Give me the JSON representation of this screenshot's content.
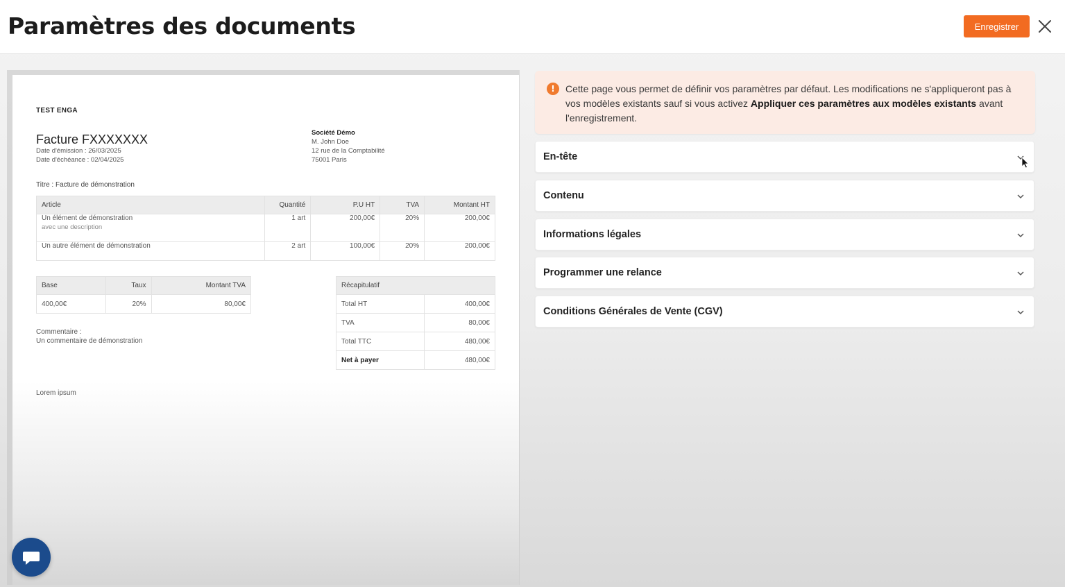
{
  "header": {
    "title": "Paramètres des documents",
    "save_label": "Enregistrer"
  },
  "document": {
    "company": "TEST ENGA",
    "invoice_title": "Facture FXXXXXXX",
    "issue_date": "Date d'émission : 26/03/2025",
    "due_date": "Date d'échéance : 02/04/2025",
    "client": {
      "name": "Société Démo",
      "contact": "M. John Doe",
      "address": "12 rue de la Comptabilité",
      "city": "75001 Paris"
    },
    "subject": "Titre : Facture de démonstration",
    "items_table": {
      "headers": [
        "Article",
        "Quantité",
        "P.U HT",
        "TVA",
        "Montant HT"
      ],
      "rows": [
        {
          "article": "Un élément de démonstration",
          "description": "avec une description",
          "qty": "1 art",
          "unit": "200,00€",
          "vat": "20%",
          "amount": "200,00€"
        },
        {
          "article": "Un autre élément de démonstration",
          "description": "",
          "qty": "2 art",
          "unit": "100,00€",
          "vat": "20%",
          "amount": "200,00€"
        }
      ]
    },
    "vat_table": {
      "headers": [
        "Base",
        "Taux",
        "Montant TVA"
      ],
      "row": [
        "400,00€",
        "20%",
        "80,00€"
      ]
    },
    "recap_table": {
      "header": "Récapitulatif",
      "rows": [
        {
          "label": "Total HT",
          "value": "400,00€"
        },
        {
          "label": "TVA",
          "value": "80,00€"
        },
        {
          "label": "Total TTC",
          "value": "480,00€"
        },
        {
          "label": "Net à payer",
          "value": "480,00€"
        }
      ]
    },
    "comment_label": "Commentaire :",
    "comment_text": "Un commentaire de démonstration",
    "footer_text": "Lorem ipsum"
  },
  "info": {
    "text_before": "Cette page vous permet de définir vos paramètres par défaut. Les modifications ne s'appliqueront pas à vos modèles existants sauf si vous activez ",
    "text_bold": "Appliquer ces paramètres aux modèles existants",
    "text_after": " avant l'enregistrement."
  },
  "sections": [
    {
      "label": "En-tête"
    },
    {
      "label": "Contenu"
    },
    {
      "label": "Informations légales"
    },
    {
      "label": "Programmer une relance"
    },
    {
      "label": "Conditions Générales de Vente (CGV)"
    }
  ],
  "colors": {
    "accent": "#f26b21",
    "info_bg": "#fcebe4",
    "chat_button": "#1b4b8c"
  },
  "icons": [
    "close-icon",
    "info-icon",
    "chevron-down-icon",
    "chat-icon",
    "mouse-cursor-icon"
  ]
}
